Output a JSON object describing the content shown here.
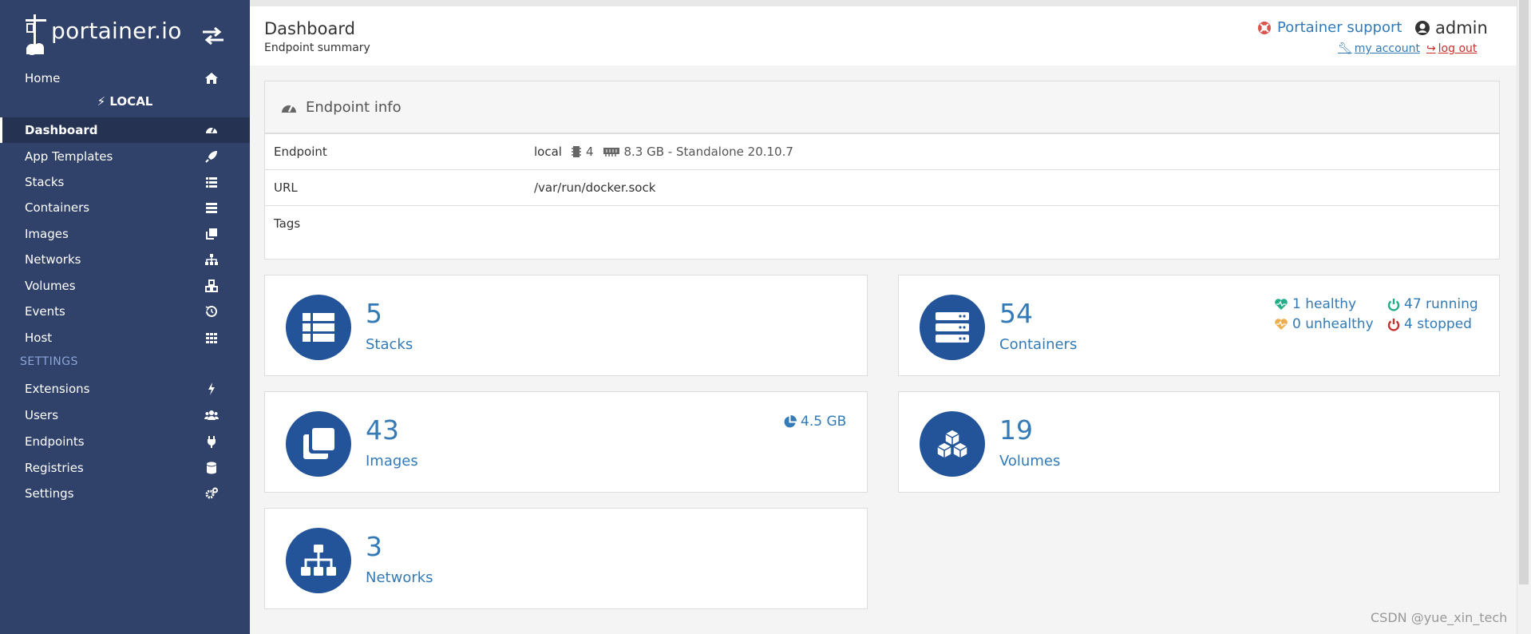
{
  "brand": {
    "logo_text": "portainer.io"
  },
  "sidebar": {
    "home": {
      "label": "Home",
      "icon": "home-icon"
    },
    "endpoint_header": "LOCAL",
    "items": [
      {
        "label": "Dashboard",
        "icon": "dashboard-icon",
        "active": true
      },
      {
        "label": "App Templates",
        "icon": "rocket-icon"
      },
      {
        "label": "Stacks",
        "icon": "list-icon"
      },
      {
        "label": "Containers",
        "icon": "server-icon"
      },
      {
        "label": "Images",
        "icon": "clone-icon"
      },
      {
        "label": "Networks",
        "icon": "sitemap-icon"
      },
      {
        "label": "Volumes",
        "icon": "cubes-icon"
      },
      {
        "label": "Events",
        "icon": "history-icon"
      },
      {
        "label": "Host",
        "icon": "th-icon"
      }
    ],
    "settings_header": "SETTINGS",
    "settings_items": [
      {
        "label": "Extensions",
        "icon": "bolt-icon"
      },
      {
        "label": "Users",
        "icon": "users-icon"
      },
      {
        "label": "Endpoints",
        "icon": "plug-icon"
      },
      {
        "label": "Registries",
        "icon": "database-icon"
      },
      {
        "label": "Settings",
        "icon": "cogs-icon"
      }
    ]
  },
  "header": {
    "title": "Dashboard",
    "subtitle": "Endpoint summary",
    "support": "Portainer support",
    "user": "admin",
    "my_account": "my account",
    "log_out": "log out"
  },
  "endpoint_info": {
    "title": "Endpoint info",
    "rows": {
      "endpoint": {
        "key": "Endpoint",
        "name": "local",
        "cpu": "4",
        "memory": "8.3 GB - Standalone 20.10.7"
      },
      "url": {
        "key": "URL",
        "value": "/var/run/docker.sock"
      },
      "tags": {
        "key": "Tags",
        "value": ""
      }
    }
  },
  "cards": {
    "stacks": {
      "count": "5",
      "label": "Stacks"
    },
    "containers": {
      "count": "54",
      "label": "Containers",
      "healthy": "1 healthy",
      "unhealthy": "0 unhealthy",
      "running": "47 running",
      "stopped": "4 stopped"
    },
    "images": {
      "count": "43",
      "label": "Images",
      "size": "4.5 GB"
    },
    "volumes": {
      "count": "19",
      "label": "Volumes"
    },
    "networks": {
      "count": "3",
      "label": "Networks"
    }
  },
  "colors": {
    "sidebar_bg": "#30426a",
    "accent": "#337ab7",
    "icon_circle": "#23549a",
    "healthy": "#23ae89",
    "unhealthy": "#f0ad4e",
    "stopped": "#c9302c"
  },
  "watermark": "CSDN @yue_xin_tech"
}
